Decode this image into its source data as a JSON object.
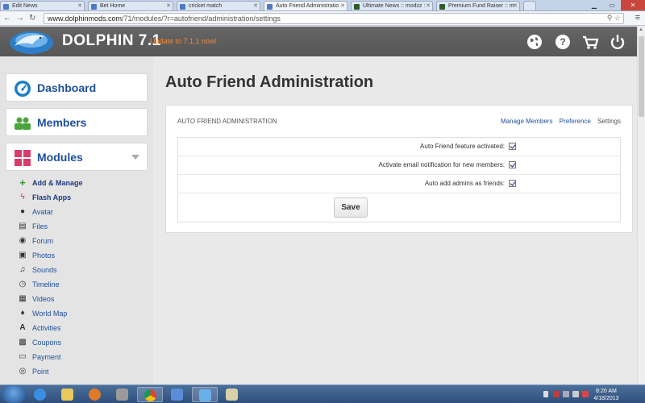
{
  "browser": {
    "tabs": [
      {
        "label": "Edit News"
      },
      {
        "label": "Bet Home"
      },
      {
        "label": "cricket match"
      },
      {
        "label": "Auto Friend Administratio"
      },
      {
        "label": "Ultimate News :: modzz :"
      },
      {
        "label": "Premium Fund Raiser :: m"
      }
    ],
    "url_host": "www.dolphinmods.com",
    "url_path": "/71/modules/?r=autofriend/administration/settings"
  },
  "header": {
    "site_name": "DOLPHIN 7.1",
    "update_link": "Update to 7.1.1 now!",
    "icons": [
      "globe-icon",
      "help-icon",
      "cart-icon",
      "power-icon"
    ]
  },
  "sidebar": {
    "dashboard": "Dashboard",
    "members": "Members",
    "modules": "Modules",
    "module_items": [
      {
        "label": "Add & Manage",
        "icon": "plus-icon"
      },
      {
        "label": "Flash Apps",
        "icon": "flash-icon"
      },
      {
        "label": "Avatar",
        "icon": "user-icon"
      },
      {
        "label": "Files",
        "icon": "file-icon"
      },
      {
        "label": "Forum",
        "icon": "chat-icon"
      },
      {
        "label": "Photos",
        "icon": "photo-icon"
      },
      {
        "label": "Sounds",
        "icon": "music-icon"
      },
      {
        "label": "Timeline",
        "icon": "clock-icon"
      },
      {
        "label": "Videos",
        "icon": "film-icon"
      },
      {
        "label": "World Map",
        "icon": "map-marker-icon"
      },
      {
        "label": "Activities",
        "icon": "activities-icon"
      },
      {
        "label": "Coupons",
        "icon": "qr-icon"
      },
      {
        "label": "Payment",
        "icon": "card-icon"
      },
      {
        "label": "Point",
        "icon": "target-icon"
      }
    ]
  },
  "main": {
    "page_title": "Auto Friend Administration",
    "panel_title": "AUTO FRIEND ADMINISTRATION",
    "panel_tabs": {
      "manage_members": "Manage Members",
      "preference": "Preference",
      "settings": "Settings"
    },
    "settings": [
      {
        "label": "Auto Friend feature activated:",
        "checked": true
      },
      {
        "label": "Activate email notification for new members:",
        "checked": true
      },
      {
        "label": "Auto add admins as friends:",
        "checked": true
      }
    ],
    "save_label": "Save"
  },
  "taskbar": {
    "time": "8:20 AM",
    "date": "4/18/2013"
  }
}
